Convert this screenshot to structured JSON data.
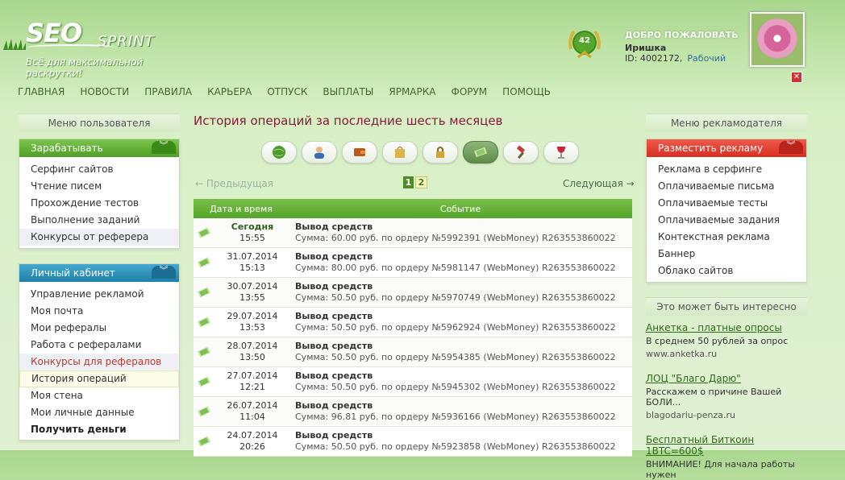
{
  "logo": {
    "seo": "SEO",
    "sprint": "SPRINT",
    "tagline": "Всё для максимальной раскрутки!"
  },
  "user": {
    "badge": "42",
    "welcome": "ДОБРО ПОЖАЛОВАТЬ",
    "name": "Иришка",
    "id_label": "ID: 4002172,",
    "status": "Рабочий"
  },
  "nav": [
    "ГЛАВНАЯ",
    "НОВОСТИ",
    "ПРАВИЛА",
    "КАРЬЕРА",
    "ОТПУСК",
    "ВЫПЛАТЫ",
    "ЯРМАРКА",
    "ФОРУМ",
    "ПОМОЩЬ"
  ],
  "left": {
    "title": "Меню пользователя",
    "earn": {
      "header": "Зарабатывать",
      "items": [
        "Серфинг сайтов",
        "Чтение писем",
        "Прохождение тестов",
        "Выполнение заданий",
        "Конкурсы от реферера"
      ]
    },
    "cabinet": {
      "header": "Личный кабинет",
      "items": [
        "Управление рекламой",
        "Моя почта",
        "Мои рефералы",
        "Работа с рефералами",
        "Конкурсы для рефералов",
        "История операций",
        "Моя стена",
        "Мои личные данные",
        "Получить деньги"
      ]
    }
  },
  "main": {
    "title": "История операций за последние шесть месяцев",
    "prev": "← Предыдущая",
    "next": "Следующая →",
    "pages": [
      "1",
      "2"
    ],
    "col_date": "Дата и время",
    "col_event": "Событие",
    "rows": [
      {
        "date": "Сегодня",
        "time": "15:55",
        "event": "Вывод средств",
        "detail": "Сумма: 60.00 руб. по ордеру №5992391 (WebMoney) R263553860022"
      },
      {
        "date": "31.07.2014",
        "time": "15:13",
        "event": "Вывод средств",
        "detail": "Сумма: 80.00 руб. по ордеру №5981147 (WebMoney) R263553860022"
      },
      {
        "date": "30.07.2014",
        "time": "13:55",
        "event": "Вывод средств",
        "detail": "Сумма: 50.50 руб. по ордеру №5970749 (WebMoney) R263553860022"
      },
      {
        "date": "29.07.2014",
        "time": "13:53",
        "event": "Вывод средств",
        "detail": "Сумма: 50.50 руб. по ордеру №5962924 (WebMoney) R263553860022"
      },
      {
        "date": "28.07.2014",
        "time": "13:50",
        "event": "Вывод средств",
        "detail": "Сумма: 50.50 руб. по ордеру №5954385 (WebMoney) R263553860022"
      },
      {
        "date": "27.07.2014",
        "time": "12:21",
        "event": "Вывод средств",
        "detail": "Сумма: 50.50 руб. по ордеру №5945302 (WebMoney) R263553860022"
      },
      {
        "date": "26.07.2014",
        "time": "11:04",
        "event": "Вывод средств",
        "detail": "Сумма: 96.81 руб. по ордеру №5936166 (WebMoney) R263553860022"
      },
      {
        "date": "24.07.2014",
        "time": "20:26",
        "event": "Вывод средств",
        "detail": "Сумма: 50.50 руб. по ордеру №5923858 (WebMoney) R263553860022"
      }
    ]
  },
  "right": {
    "title": "Меню рекламодателя",
    "ad": {
      "header": "Разместить рекламу",
      "items": [
        "Реклама в серфинге",
        "Оплачиваемые письма",
        "Оплачиваемые тесты",
        "Оплачиваемые задания",
        "Контекстная реклама",
        "Баннер",
        "Облако сайтов"
      ]
    },
    "interesting": "Это может быть интересно",
    "ads": [
      {
        "title": "Анкетка - платные опросы",
        "desc": "В среднем 50 рублей за опрос",
        "url": "www.anketka.ru"
      },
      {
        "title": "ЛОЦ \"Благо Дарю\"",
        "desc": "Расскажем о причине Вашей БОЛИ...",
        "url": "blagodariu-penza.ru"
      },
      {
        "title": "Бесплатный Биткоин 1BTC=600$",
        "desc": "ВНИМАНИЕ! Для начала работы нужен",
        "url": ""
      }
    ]
  },
  "colors": {
    "accent_green": "#55a52a",
    "title_red": "#8a1a3a",
    "ad_red": "#d52f22",
    "cabinet_blue": "#1f7fa8"
  }
}
